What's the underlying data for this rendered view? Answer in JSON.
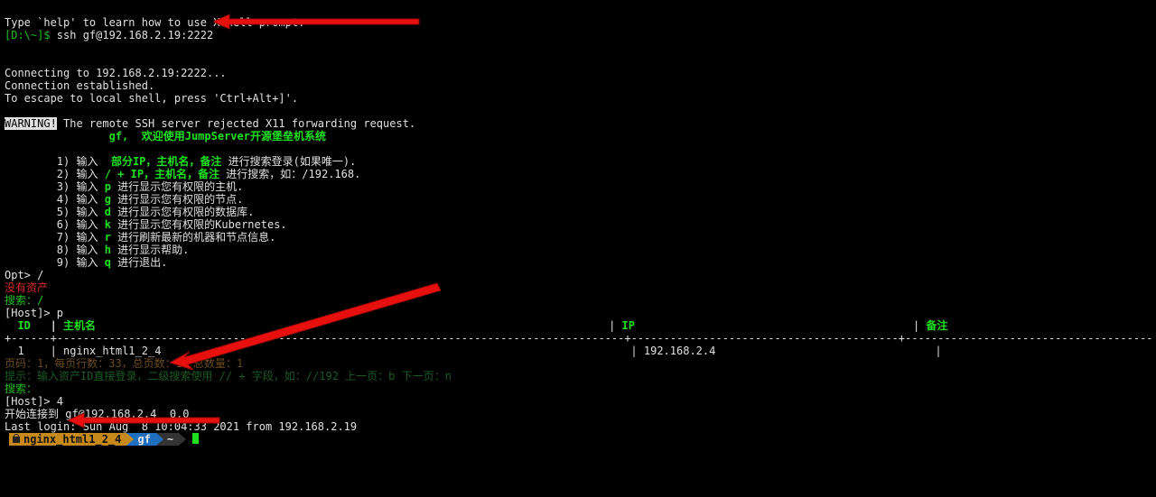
{
  "intro": {
    "help_line": "Type `help' to learn how to use Xshell prompt.",
    "local_prompt": "[D:\\~]$",
    "ssh_cmd": " ssh gf@192.168.2.19:2222"
  },
  "conn": {
    "connecting": "Connecting to 192.168.2.19:2222...",
    "established": "Connection established.",
    "escape": "To escape to local shell, press 'Ctrl+Alt+]'."
  },
  "warn": {
    "label": "WARNING!",
    "msg": " The remote SSH server rejected X11 forwarding request."
  },
  "welcome": {
    "pad": "                ",
    "text": "gf,  欢迎使用JumpServer开源堡垒机系统"
  },
  "menu": {
    "pad": "        ",
    "items": [
      {
        "n": "1",
        "pre": ") 输入  ",
        "kw": "部分IP，主机名，备注",
        "post": " 进行搜索登录(如果唯一)."
      },
      {
        "n": "2",
        "pre": ") 输入 ",
        "kw": "/ + IP，主机名，备注",
        "post": " 进行搜索，如：/192.168."
      },
      {
        "n": "3",
        "pre": ") 输入 ",
        "kw": "p",
        "post": " 进行显示您有权限的主机."
      },
      {
        "n": "4",
        "pre": ") 输入 ",
        "kw": "g",
        "post": " 进行显示您有权限的节点."
      },
      {
        "n": "5",
        "pre": ") 输入 ",
        "kw": "d",
        "post": " 进行显示您有权限的数据库."
      },
      {
        "n": "6",
        "pre": ") 输入 ",
        "kw": "k",
        "post": " 进行显示您有权限的Kubernetes."
      },
      {
        "n": "7",
        "pre": ") 输入 ",
        "kw": "r",
        "post": " 进行刷新最新的机器和节点信息."
      },
      {
        "n": "8",
        "pre": ") 输入 ",
        "kw": "h",
        "post": " 进行显示帮助."
      },
      {
        "n": "9",
        "pre": ") 输入 ",
        "kw": "q",
        "post": " 进行退出."
      }
    ]
  },
  "opt_prompt": "Opt> /",
  "no_asset": "没有资产",
  "search1": "搜索：/",
  "host_prompt1": "[Host]> p",
  "table": {
    "hdr": {
      "id": "  ID  ",
      "sp": " | ",
      "name": "主机名",
      "ip_lbl": "| IP",
      "note_lbl": "| 备注"
    },
    "row": {
      "idx": "  1   ",
      "sp": " | ",
      "name": "nginx_html1_2_4",
      "ip": "| 192.168.2.4",
      "bar": "|"
    }
  },
  "page_info": "页码：1，每页行数：33，总页数：1，总数量：1",
  "hint": "提示：输入资产ID直接登录，二级搜索使用 // + 字段，如：//192 上一页：b 下一页：n",
  "search2": "搜索：",
  "host_prompt2": "[Host]> 4",
  "start_conn": "开始连接到 gf@192.168.2.4  0.0",
  "last_login": "Last login: Sun Aug  8 10:04:33 2021 from 192.168.2.19",
  "bar": {
    "host": "nginx_html1_2_4",
    "user": "gf",
    "dir": "~"
  }
}
